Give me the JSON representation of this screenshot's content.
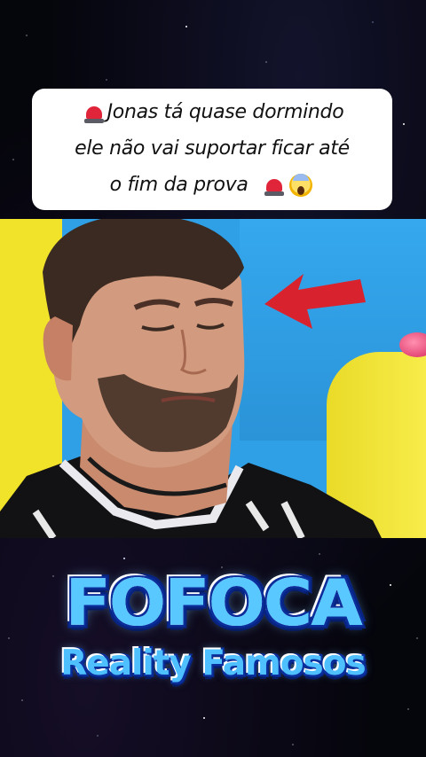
{
  "caption": {
    "line1": "Jonas tá quase dormindo",
    "line2": "ele não vai suportar ficar até",
    "line3": "o fim da prova"
  },
  "icons": {
    "siren": "siren-icon",
    "scream": "face-screaming-icon",
    "arrow": "red-arrow-icon"
  },
  "colors": {
    "arrow": "#d8232e",
    "logo_fill": "#58c8ff",
    "logo_outline": "#0a2f9c"
  },
  "logo": {
    "title": "FOFOCA",
    "subtitle": "Reality Famosos"
  }
}
